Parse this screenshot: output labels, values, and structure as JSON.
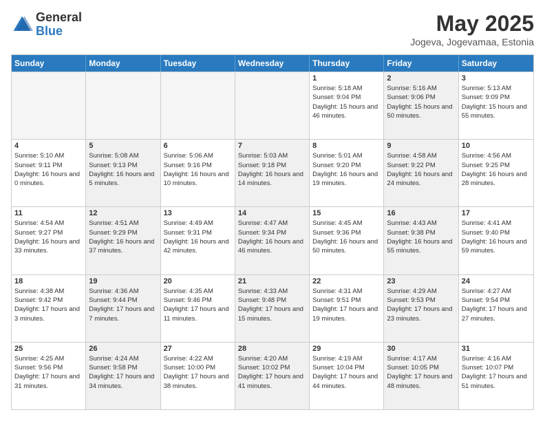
{
  "header": {
    "logo_general": "General",
    "logo_blue": "Blue",
    "month_year": "May 2025",
    "location": "Jogeva, Jogevamaa, Estonia"
  },
  "days_of_week": [
    "Sunday",
    "Monday",
    "Tuesday",
    "Wednesday",
    "Thursday",
    "Friday",
    "Saturday"
  ],
  "rows": [
    [
      {
        "day": "",
        "info": "",
        "empty": true
      },
      {
        "day": "",
        "info": "",
        "empty": true
      },
      {
        "day": "",
        "info": "",
        "empty": true
      },
      {
        "day": "",
        "info": "",
        "empty": true
      },
      {
        "day": "1",
        "info": "Sunrise: 5:18 AM\nSunset: 9:04 PM\nDaylight: 15 hours and 46 minutes."
      },
      {
        "day": "2",
        "info": "Sunrise: 5:16 AM\nSunset: 9:06 PM\nDaylight: 15 hours and 50 minutes.",
        "shaded": true
      },
      {
        "day": "3",
        "info": "Sunrise: 5:13 AM\nSunset: 9:09 PM\nDaylight: 15 hours and 55 minutes."
      }
    ],
    [
      {
        "day": "4",
        "info": "Sunrise: 5:10 AM\nSunset: 9:11 PM\nDaylight: 16 hours and 0 minutes."
      },
      {
        "day": "5",
        "info": "Sunrise: 5:08 AM\nSunset: 9:13 PM\nDaylight: 16 hours and 5 minutes.",
        "shaded": true
      },
      {
        "day": "6",
        "info": "Sunrise: 5:06 AM\nSunset: 9:16 PM\nDaylight: 16 hours and 10 minutes."
      },
      {
        "day": "7",
        "info": "Sunrise: 5:03 AM\nSunset: 9:18 PM\nDaylight: 16 hours and 14 minutes.",
        "shaded": true
      },
      {
        "day": "8",
        "info": "Sunrise: 5:01 AM\nSunset: 9:20 PM\nDaylight: 16 hours and 19 minutes."
      },
      {
        "day": "9",
        "info": "Sunrise: 4:58 AM\nSunset: 9:22 PM\nDaylight: 16 hours and 24 minutes.",
        "shaded": true
      },
      {
        "day": "10",
        "info": "Sunrise: 4:56 AM\nSunset: 9:25 PM\nDaylight: 16 hours and 28 minutes."
      }
    ],
    [
      {
        "day": "11",
        "info": "Sunrise: 4:54 AM\nSunset: 9:27 PM\nDaylight: 16 hours and 33 minutes."
      },
      {
        "day": "12",
        "info": "Sunrise: 4:51 AM\nSunset: 9:29 PM\nDaylight: 16 hours and 37 minutes.",
        "shaded": true
      },
      {
        "day": "13",
        "info": "Sunrise: 4:49 AM\nSunset: 9:31 PM\nDaylight: 16 hours and 42 minutes."
      },
      {
        "day": "14",
        "info": "Sunrise: 4:47 AM\nSunset: 9:34 PM\nDaylight: 16 hours and 46 minutes.",
        "shaded": true
      },
      {
        "day": "15",
        "info": "Sunrise: 4:45 AM\nSunset: 9:36 PM\nDaylight: 16 hours and 50 minutes."
      },
      {
        "day": "16",
        "info": "Sunrise: 4:43 AM\nSunset: 9:38 PM\nDaylight: 16 hours and 55 minutes.",
        "shaded": true
      },
      {
        "day": "17",
        "info": "Sunrise: 4:41 AM\nSunset: 9:40 PM\nDaylight: 16 hours and 59 minutes."
      }
    ],
    [
      {
        "day": "18",
        "info": "Sunrise: 4:38 AM\nSunset: 9:42 PM\nDaylight: 17 hours and 3 minutes."
      },
      {
        "day": "19",
        "info": "Sunrise: 4:36 AM\nSunset: 9:44 PM\nDaylight: 17 hours and 7 minutes.",
        "shaded": true
      },
      {
        "day": "20",
        "info": "Sunrise: 4:35 AM\nSunset: 9:46 PM\nDaylight: 17 hours and 11 minutes."
      },
      {
        "day": "21",
        "info": "Sunrise: 4:33 AM\nSunset: 9:48 PM\nDaylight: 17 hours and 15 minutes.",
        "shaded": true
      },
      {
        "day": "22",
        "info": "Sunrise: 4:31 AM\nSunset: 9:51 PM\nDaylight: 17 hours and 19 minutes."
      },
      {
        "day": "23",
        "info": "Sunrise: 4:29 AM\nSunset: 9:53 PM\nDaylight: 17 hours and 23 minutes.",
        "shaded": true
      },
      {
        "day": "24",
        "info": "Sunrise: 4:27 AM\nSunset: 9:54 PM\nDaylight: 17 hours and 27 minutes."
      }
    ],
    [
      {
        "day": "25",
        "info": "Sunrise: 4:25 AM\nSunset: 9:56 PM\nDaylight: 17 hours and 31 minutes."
      },
      {
        "day": "26",
        "info": "Sunrise: 4:24 AM\nSunset: 9:58 PM\nDaylight: 17 hours and 34 minutes.",
        "shaded": true
      },
      {
        "day": "27",
        "info": "Sunrise: 4:22 AM\nSunset: 10:00 PM\nDaylight: 17 hours and 38 minutes."
      },
      {
        "day": "28",
        "info": "Sunrise: 4:20 AM\nSunset: 10:02 PM\nDaylight: 17 hours and 41 minutes.",
        "shaded": true
      },
      {
        "day": "29",
        "info": "Sunrise: 4:19 AM\nSunset: 10:04 PM\nDaylight: 17 hours and 44 minutes."
      },
      {
        "day": "30",
        "info": "Sunrise: 4:17 AM\nSunset: 10:05 PM\nDaylight: 17 hours and 48 minutes.",
        "shaded": true
      },
      {
        "day": "31",
        "info": "Sunrise: 4:16 AM\nSunset: 10:07 PM\nDaylight: 17 hours and 51 minutes."
      }
    ]
  ]
}
